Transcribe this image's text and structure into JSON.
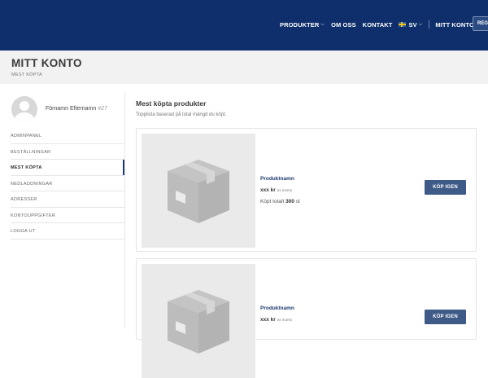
{
  "nav": {
    "products_label": "PRODUKTER",
    "about_label": "OM OSS",
    "contact_label": "KONTAKT",
    "language_label": "SV",
    "account_label": "MITT KONTO",
    "register_label": "REG"
  },
  "page": {
    "title": "MITT KONTO",
    "breadcrumb": "MEST KÖPTA"
  },
  "user": {
    "name": "Förnamn Efternamn",
    "number": "#27"
  },
  "sidebar": {
    "items": [
      {
        "label": "ADMINPANEL"
      },
      {
        "label": "BESTÄLLNINGAR"
      },
      {
        "label": "MEST KÖPTA"
      },
      {
        "label": "NEDLADDNINGAR"
      },
      {
        "label": "ADRESSER"
      },
      {
        "label": "KONTOUPPGIFTER"
      },
      {
        "label": "LOGGA UT"
      }
    ]
  },
  "main": {
    "title": "Mest köpta produkter",
    "subtitle": "Topplista baserad på total mängd du köpt."
  },
  "products": [
    {
      "name": "Produktnamn",
      "price": "xxx kr",
      "vat": "ex moms",
      "total_prefix": "Köpt totalt",
      "total_qty": "300",
      "total_unit": "st",
      "button": "KÖP IGEN"
    },
    {
      "name": "Produktnamn",
      "price": "xxx kr",
      "vat": "ex moms",
      "button": "KÖP IGEN"
    }
  ],
  "colors": {
    "header_bg": "#0e2f6b",
    "button_bg": "#3e5a87",
    "accent": "#1e3a70"
  }
}
